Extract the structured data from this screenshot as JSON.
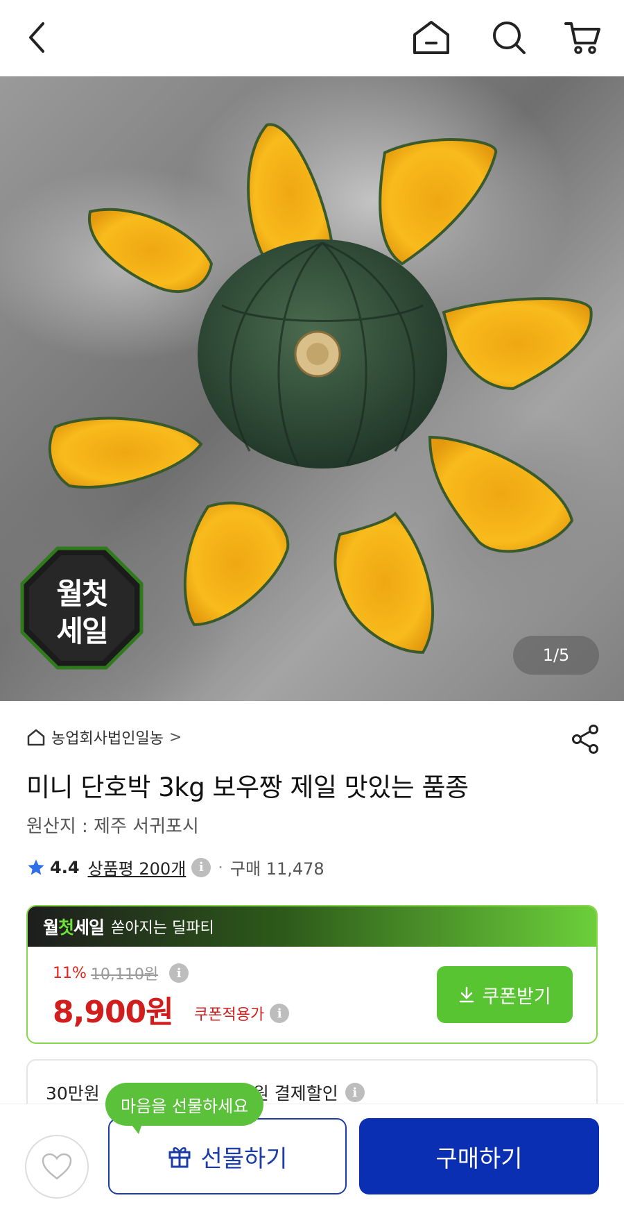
{
  "product": {
    "image_counter": "1/5",
    "badge_line1": "월첫",
    "badge_line2": "세일",
    "seller": "농업회사법인일농",
    "seller_chevron": ">",
    "title": "미니 단호박 3kg 보우짱 제일 맛있는 품종",
    "origin": "원산지 : 제주 서귀포시",
    "rating": "4.4",
    "reviews": "상품평 200개",
    "separator": "·",
    "purchases": "구매 11,478"
  },
  "deal": {
    "logo_part1": "월",
    "logo_part2": "첫",
    "logo_part3": "세일",
    "tagline": "쏟아지는 딜파티",
    "discount_pct": "11%",
    "original_price": "10,110원",
    "price": "8,900원",
    "price_label": "쿠폰적용가",
    "coupon_button": "쿠폰받기"
  },
  "payment": {
    "text_left": "30만원",
    "text_right": "만원 결제할인"
  },
  "bottom": {
    "tooltip": "마음을 선물하세요",
    "gift_button": "선물하기",
    "buy_button": "구매하기"
  },
  "colors": {
    "accent_green": "#58c432",
    "primary_blue": "#0a2fb2",
    "price_red": "#d21d1d"
  },
  "icons": [
    "back-arrow-icon",
    "home-icon",
    "search-icon",
    "cart-icon",
    "share-icon",
    "star-icon",
    "info-icon",
    "download-icon",
    "heart-icon",
    "gift-icon",
    "chevron-down-icon"
  ]
}
